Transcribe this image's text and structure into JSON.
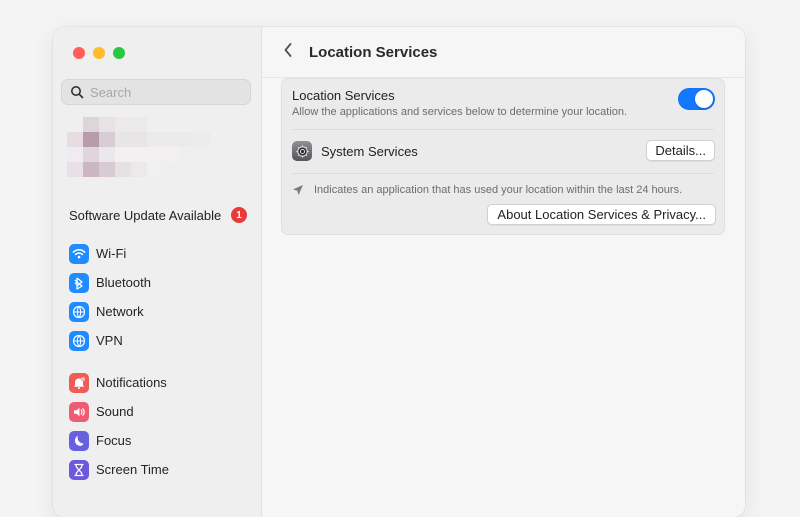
{
  "sidebar": {
    "search": {
      "placeholder": "Search"
    },
    "update": {
      "label": "Software Update Available",
      "count": "1"
    },
    "groups": [
      [
        {
          "label": "Wi-Fi",
          "icon": "wifi-icon",
          "color": "#1f8cff"
        },
        {
          "label": "Bluetooth",
          "icon": "bluetooth-icon",
          "color": "#1f8cff"
        },
        {
          "label": "Network",
          "icon": "network-icon",
          "color": "#1f8cff"
        },
        {
          "label": "VPN",
          "icon": "vpn-icon",
          "color": "#1f8cff"
        }
      ],
      [
        {
          "label": "Notifications",
          "icon": "notifications-icon",
          "color": "#ef5b55"
        },
        {
          "label": "Sound",
          "icon": "sound-icon",
          "color": "#ef5b73"
        },
        {
          "label": "Focus",
          "icon": "focus-icon",
          "color": "#6861df"
        },
        {
          "label": "Screen Time",
          "icon": "screen-time-icon",
          "color": "#6c58db"
        }
      ]
    ]
  },
  "main": {
    "title": "Location Services",
    "location_services": {
      "label": "Location Services",
      "description": "Allow the applications and services below to determine your location.",
      "enabled": true
    },
    "system_services": {
      "label": "System Services",
      "details_label": "Details..."
    },
    "note": "Indicates an application that has used your location within the last 24 hours.",
    "about_label": "About Location Services & Privacy..."
  },
  "colors": {
    "accent": "#1477ff",
    "badge": "#e8393b",
    "close": "#ff5f57",
    "minimize": "#febc2e",
    "zoom": "#28c840"
  }
}
